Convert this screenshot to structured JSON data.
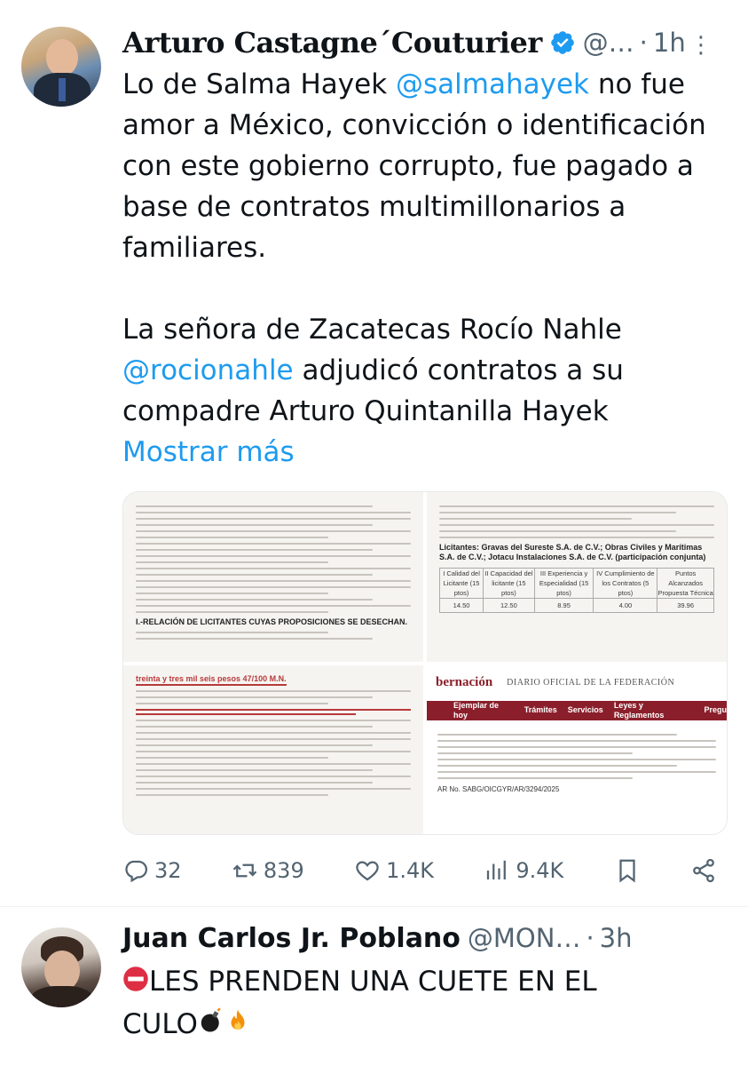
{
  "tweet1": {
    "author_name": "Arturo Castagne´Couturier",
    "handle": "@…",
    "separator": "·",
    "time": "1h",
    "more_label": "⋮",
    "text_line1_pre": "Lo de Salma Hayek ",
    "mention1": "@salmahayek",
    "text_line1_post": " no fue amor a México, convicción o identificación con este gobierno corrupto, fue pagado a base de contratos multimillonarios a familiares.",
    "text_para2_pre": "La señora de Zacatecas Rocío Nahle ",
    "mention2": "@rocionahle",
    "text_para2_post": " adjudicó contratos a su compadre Arturo Quintanilla Hayek",
    "show_more": "Mostrar más",
    "media": {
      "doc1_title": "I.-RELACIÓN DE LICITANTES CUYAS PROPOSICIONES SE DESECHAN.",
      "doc2_title": "Licitantes: Gravas del Sureste S.A. de C.V.; Obras Civiles y Marítimas S.A. de C.V.; Jotacu Instalaciones S.A. de C.V. (participación conjunta)",
      "doc2_values": [
        "14.50",
        "12.50",
        "8.95",
        "4.00",
        "39.96"
      ],
      "doc2_headers": [
        "I Calidad del Licitante (15 ptos)",
        "II Capacidad del licitante (15 ptos)",
        "III Experiencia y Especialidad (15 ptos)",
        "IV Cumplimiento de los Contratos (5 ptos)",
        "Puntos Alcanzados Propuesta Técnica"
      ],
      "doc3_highlight": "treinta y tres mil seis pesos 47/100 M.N.",
      "doc4_brand": "bernación",
      "doc4_title": "DIARIO OFICIAL DE LA FEDERACIÓN",
      "doc4_nav": [
        "Ejemplar de hoy",
        "Trámites",
        "Servicios",
        "Leyes y Reglamentos",
        "Pregu"
      ],
      "doc4_ref": "AR No. SABG/OICGYR/AR/3294/2025"
    },
    "stats": {
      "replies": "32",
      "reposts": "839",
      "likes": "1.4K",
      "views": "9.4K"
    }
  },
  "tweet2": {
    "author_name": "Juan Carlos Jr. Poblano",
    "handle": "@MON…",
    "separator": "·",
    "time": "3h",
    "text_line1": "LES PRENDEN UNA CUETE EN EL",
    "text_line2": "CULO"
  },
  "colors": {
    "accent": "#1d9bf0",
    "muted": "#536471",
    "text": "#0f1419"
  }
}
